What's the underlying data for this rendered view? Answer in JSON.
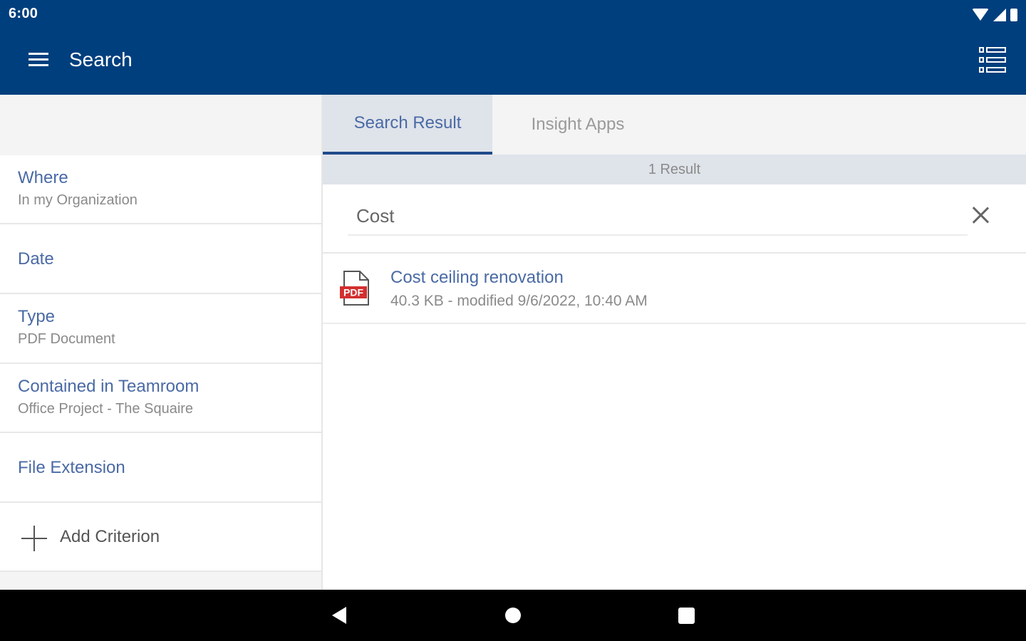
{
  "status_bar": {
    "time": "6:00",
    "icons": [
      "wifi-icon",
      "signal-icon",
      "battery-icon"
    ]
  },
  "app_bar": {
    "menu_icon": "hamburger-menu-icon",
    "title": "Search",
    "view_toggle_icon": "list-view-icon",
    "background_color": "#003f7d"
  },
  "criteria": [
    {
      "title": "Where",
      "value": "In my Organization"
    },
    {
      "title": "Date",
      "value": ""
    },
    {
      "title": "Type",
      "value": "PDF Document"
    },
    {
      "title": "Contained in Teamroom",
      "value": "Office Project - The Squaire"
    },
    {
      "title": "File Extension",
      "value": ""
    }
  ],
  "add_criterion": {
    "icon": "plus-icon",
    "label": "Add Criterion"
  },
  "tabs": [
    {
      "label": "Search Result",
      "active": true
    },
    {
      "label": "Insight Apps",
      "active": false
    }
  ],
  "result_count": "1 Result",
  "search": {
    "value": "Cost",
    "clear_icon": "close-icon"
  },
  "results": [
    {
      "icon": "pdf-file-icon",
      "icon_label": "PDF",
      "title": "Cost ceiling renovation",
      "meta": "40.3 KB - modified 9/6/2022, 10:40 AM"
    }
  ],
  "nav_bar": {
    "icons": [
      "back-icon",
      "home-icon",
      "recents-icon"
    ]
  },
  "colors": {
    "accent": "#003f7d",
    "link_text": "#4a6aa5",
    "tab_active_bg": "#dfe3ea",
    "pdf_red": "#d32f2f"
  }
}
